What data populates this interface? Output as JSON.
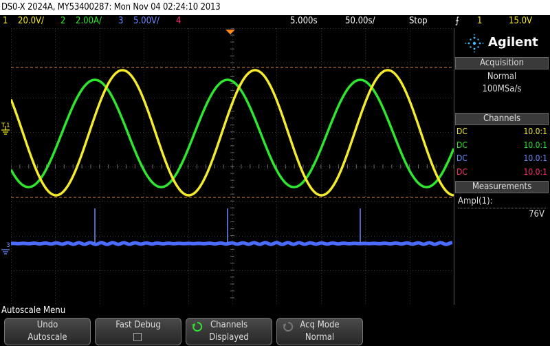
{
  "title": "DS0-X 2024A, MY53400287: Mon Nov 04 02:24:10 2013",
  "status": {
    "ch1_num": "1",
    "ch1_scale": "20.0V/",
    "ch2_num": "2",
    "ch2_scale": "2.00A/",
    "ch3_num": "3",
    "ch3_scale": "5.00V/",
    "ch4_num": "4",
    "timebase_delay": "5.000s",
    "timebase_scale": "50.00s/",
    "run_state": "Stop",
    "trigger_source": "1",
    "trigger_level": "15.0V"
  },
  "colors": {
    "ch1": "#f5eb2a",
    "ch2": "#2ee62e",
    "ch3": "#4a6cff",
    "ch4": "#ff3070",
    "trigger": "#ff8a1c"
  },
  "brand": "Agilent",
  "acquisition": {
    "title": "Acquisition",
    "mode": "Normal",
    "rate": "100MSa/s"
  },
  "channels_panel": {
    "title": "Channels",
    "rows": [
      {
        "coupling": "DC",
        "probe": "10.0:1"
      },
      {
        "coupling": "DC",
        "probe": "10.0:1"
      },
      {
        "coupling": "DC",
        "probe": "10.0:1"
      },
      {
        "coupling": "DC",
        "probe": "10.0:1"
      }
    ]
  },
  "measurements": {
    "title": "Measurements",
    "label": "Ampl(1):",
    "value": "76V"
  },
  "markers": {
    "ch1": "1",
    "ch2": "2",
    "ch3": "3",
    "trigger": "T"
  },
  "menu_label": "Autoscale Menu",
  "softkeys": [
    {
      "line1": "Undo",
      "line2": "Autoscale"
    },
    {
      "line1": "Fast Debug",
      "line2": ""
    },
    {
      "line1": "Channels",
      "line2": "Displayed"
    },
    {
      "line1": "Acq Mode",
      "line2": "Normal"
    }
  ]
}
